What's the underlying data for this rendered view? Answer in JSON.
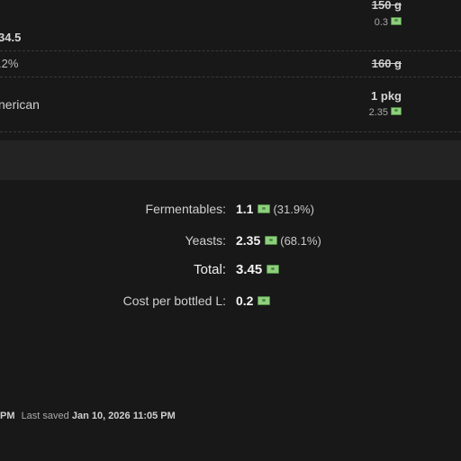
{
  "ingredients": [
    {
      "name": "",
      "detail": "",
      "amount": "150 g",
      "price": "0.3",
      "struck": true
    },
    {
      "name": "34.5",
      "detail": "",
      "amount": "",
      "price": "",
      "struck": false
    },
    {
      "name": "",
      "detail": ".2%",
      "amount": "160 g",
      "price": "",
      "struck": true
    },
    {
      "name": "nerican",
      "detail": "",
      "amount": "1 pkg",
      "price": "2.35",
      "struck": false
    }
  ],
  "costs": {
    "fermentables_label": "Fermentables:",
    "fermentables_value": "1.1",
    "fermentables_pct": "(31.9%)",
    "yeasts_label": "Yeasts:",
    "yeasts_value": "2.35",
    "yeasts_pct": "(68.1%)",
    "total_label": "Total:",
    "total_value": "3.45",
    "per_liter_label": "Cost per bottled L:",
    "per_liter_value": "0.2"
  },
  "footer": {
    "left_fragment": "PM",
    "last_saved_label": "Last saved",
    "last_saved_value": "Jan 10, 2026 11:05 PM"
  },
  "icons": {
    "currency": "money-bill-icon"
  },
  "colors": {
    "background": "#181818",
    "money_icon": "#8ecf7e"
  }
}
